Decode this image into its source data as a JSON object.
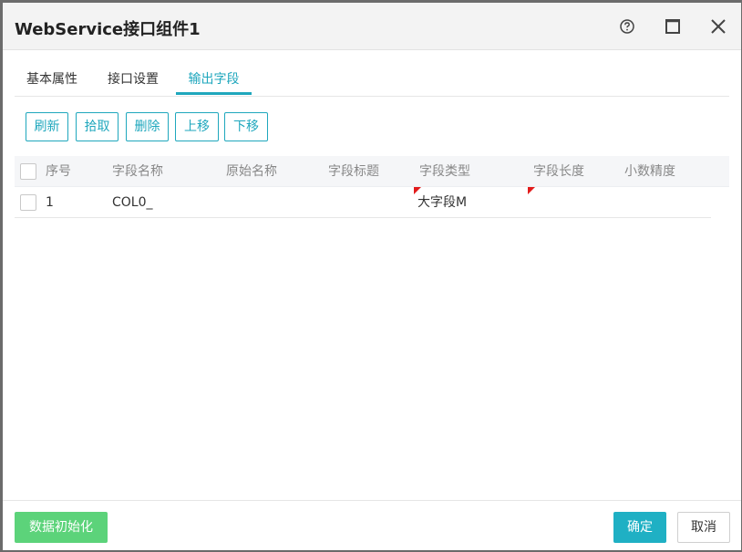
{
  "dialog": {
    "title": "WebService接口组件1"
  },
  "titlebar_icons": [
    "help-circle-icon",
    "maximize-icon",
    "close-icon"
  ],
  "tabs": [
    {
      "label": "基本属性",
      "active": false
    },
    {
      "label": "接口设置",
      "active": false
    },
    {
      "label": "输出字段",
      "active": true
    }
  ],
  "toolbar": {
    "refresh": "刷新",
    "pick": "拾取",
    "delete": "删除",
    "move_up": "上移",
    "move_down": "下移"
  },
  "table": {
    "columns": [
      "序号",
      "字段名称",
      "原始名称",
      "字段标题",
      "字段类型",
      "字段长度",
      "小数精度"
    ],
    "rows": [
      {
        "index": "1",
        "field_name": "COL0_",
        "original_name": "",
        "field_title": "",
        "field_type": "大字段M",
        "field_length": "",
        "decimal_precision": ""
      }
    ]
  },
  "footer": {
    "init_data": "数据初始化",
    "confirm": "确定",
    "cancel": "取消"
  },
  "colors": {
    "accent": "#1fa7bd",
    "success": "#5cd37a",
    "confirm": "#1fb0c4",
    "marker": "#e21b1b"
  }
}
